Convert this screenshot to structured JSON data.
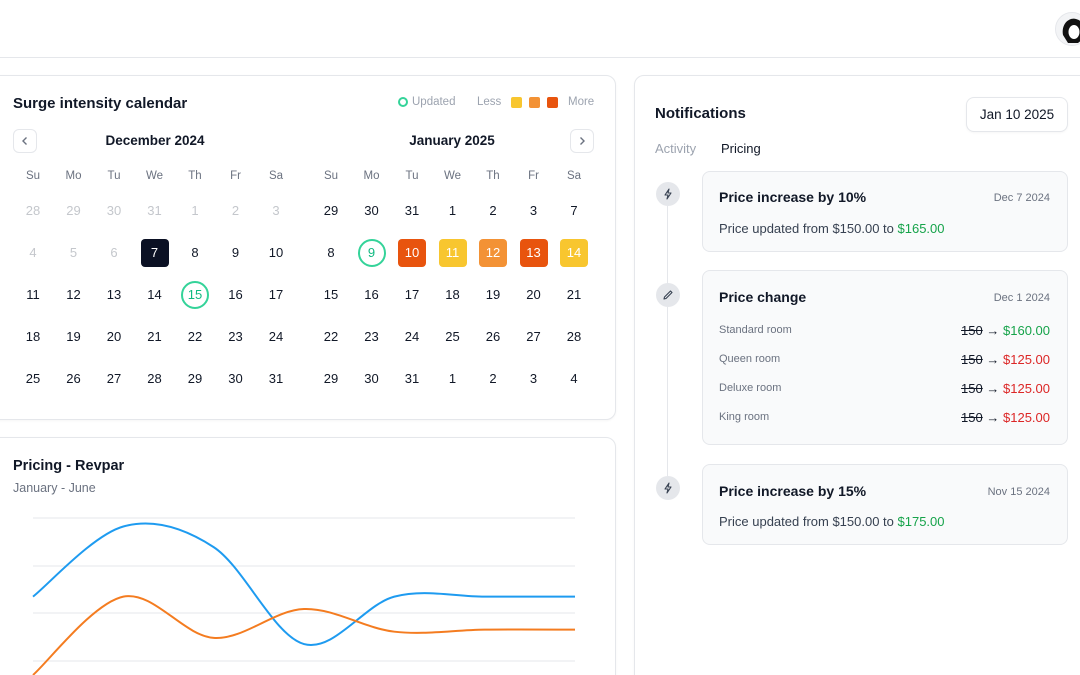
{
  "header": {
    "avatar_icon": "user-avatar"
  },
  "calendar": {
    "title": "Surge intensity calendar",
    "legend": {
      "updated_label": "Updated",
      "less_label": "Less",
      "more_label": "More",
      "colors": [
        "#f8c62f",
        "#f39235",
        "#e8540e"
      ]
    },
    "weekdays": [
      "Su",
      "Mo",
      "Tu",
      "We",
      "Th",
      "Fr",
      "Sa"
    ],
    "prev_icon": "chevron-left-icon",
    "next_icon": "chevron-right-icon",
    "months": [
      {
        "title": "December 2024",
        "weeks": [
          [
            {
              "d": "28",
              "s": "muted"
            },
            {
              "d": "29",
              "s": "muted"
            },
            {
              "d": "30",
              "s": "muted"
            },
            {
              "d": "31",
              "s": "muted"
            },
            {
              "d": "1",
              "s": "muted"
            },
            {
              "d": "2",
              "s": "muted"
            },
            {
              "d": "3",
              "s": "muted"
            }
          ],
          [
            {
              "d": "4",
              "s": "muted"
            },
            {
              "d": "5",
              "s": "muted"
            },
            {
              "d": "6",
              "s": "muted"
            },
            {
              "d": "7",
              "s": "selected"
            },
            {
              "d": "8"
            },
            {
              "d": "9"
            },
            {
              "d": "10"
            }
          ],
          [
            {
              "d": "11"
            },
            {
              "d": "12"
            },
            {
              "d": "13"
            },
            {
              "d": "14"
            },
            {
              "d": "15",
              "s": "updated"
            },
            {
              "d": "16"
            },
            {
              "d": "17"
            }
          ],
          [
            {
              "d": "18"
            },
            {
              "d": "19"
            },
            {
              "d": "20"
            },
            {
              "d": "21"
            },
            {
              "d": "22"
            },
            {
              "d": "23"
            },
            {
              "d": "24"
            }
          ],
          [
            {
              "d": "25"
            },
            {
              "d": "26"
            },
            {
              "d": "27"
            },
            {
              "d": "28"
            },
            {
              "d": "29"
            },
            {
              "d": "30"
            },
            {
              "d": "31"
            }
          ]
        ]
      },
      {
        "title": "January 2025",
        "weeks": [
          [
            {
              "d": "29"
            },
            {
              "d": "30"
            },
            {
              "d": "31"
            },
            {
              "d": "1"
            },
            {
              "d": "2"
            },
            {
              "d": "3"
            },
            {
              "d": "7"
            }
          ],
          [
            {
              "d": "8"
            },
            {
              "d": "9",
              "s": "updated"
            },
            {
              "d": "10",
              "s": "heat",
              "c": "#e8540e"
            },
            {
              "d": "11",
              "s": "heat",
              "c": "#f8c62f"
            },
            {
              "d": "12",
              "s": "heat",
              "c": "#f39235"
            },
            {
              "d": "13",
              "s": "heat",
              "c": "#e8540e"
            },
            {
              "d": "14",
              "s": "heat",
              "c": "#f8c62f"
            }
          ],
          [
            {
              "d": "15"
            },
            {
              "d": "16"
            },
            {
              "d": "17"
            },
            {
              "d": "18"
            },
            {
              "d": "19"
            },
            {
              "d": "20"
            },
            {
              "d": "21"
            }
          ],
          [
            {
              "d": "22"
            },
            {
              "d": "23"
            },
            {
              "d": "24"
            },
            {
              "d": "25"
            },
            {
              "d": "26"
            },
            {
              "d": "27"
            },
            {
              "d": "28"
            }
          ],
          [
            {
              "d": "29"
            },
            {
              "d": "30"
            },
            {
              "d": "31"
            },
            {
              "d": "1"
            },
            {
              "d": "2"
            },
            {
              "d": "3"
            },
            {
              "d": "4"
            }
          ]
        ]
      }
    ]
  },
  "chart": {
    "title": "Pricing - Revpar",
    "subtitle": "January - June",
    "colors": {
      "series_a": "#1e9bf0",
      "series_b": "#f47c20",
      "grid": "#e5e7eb"
    }
  },
  "chart_data": {
    "type": "line",
    "title": "Pricing - Revpar",
    "subtitle": "January - June",
    "xlabel": "",
    "ylabel": "",
    "x": [
      0,
      1,
      2,
      3,
      4,
      5,
      6
    ],
    "series": [
      {
        "values": [
          38,
          72,
          62,
          15,
          38,
          38
        ]
      },
      {
        "values": [
          0,
          38,
          18,
          32,
          21,
          22
        ]
      }
    ],
    "ylim": [
      0,
      80
    ],
    "grid": true
  },
  "notifications": {
    "title": "Notifications",
    "date_button": "Jan 10 2025",
    "tabs": [
      {
        "label": "Activity",
        "active": false
      },
      {
        "label": "Pricing",
        "active": true
      }
    ],
    "items": [
      {
        "icon": "lightning-icon",
        "title": "Price increase by 10%",
        "date": "Dec 7 2024",
        "text_prefix": "Price updated from $150.00 to ",
        "text_value": "$165.00"
      },
      {
        "icon": "pencil-icon",
        "title": "Price change",
        "date": "Dec 1 2024",
        "rooms": [
          {
            "name": "Standard room",
            "old": "150",
            "arrow": "→",
            "new": "$160.00",
            "color": "green"
          },
          {
            "name": "Queen room",
            "old": "150",
            "arrow": "→",
            "new": "$125.00",
            "color": "red"
          },
          {
            "name": "Deluxe room",
            "old": "150",
            "arrow": "→",
            "new": "$125.00",
            "color": "red"
          },
          {
            "name": "King room",
            "old": "150",
            "arrow": "→",
            "new": "$125.00",
            "color": "red"
          }
        ]
      },
      {
        "icon": "lightning-icon",
        "title": "Price increase by 15%",
        "date": "Nov 15 2024",
        "text_prefix": "Price updated from $150.00 to ",
        "text_value": "$175.00"
      }
    ]
  }
}
